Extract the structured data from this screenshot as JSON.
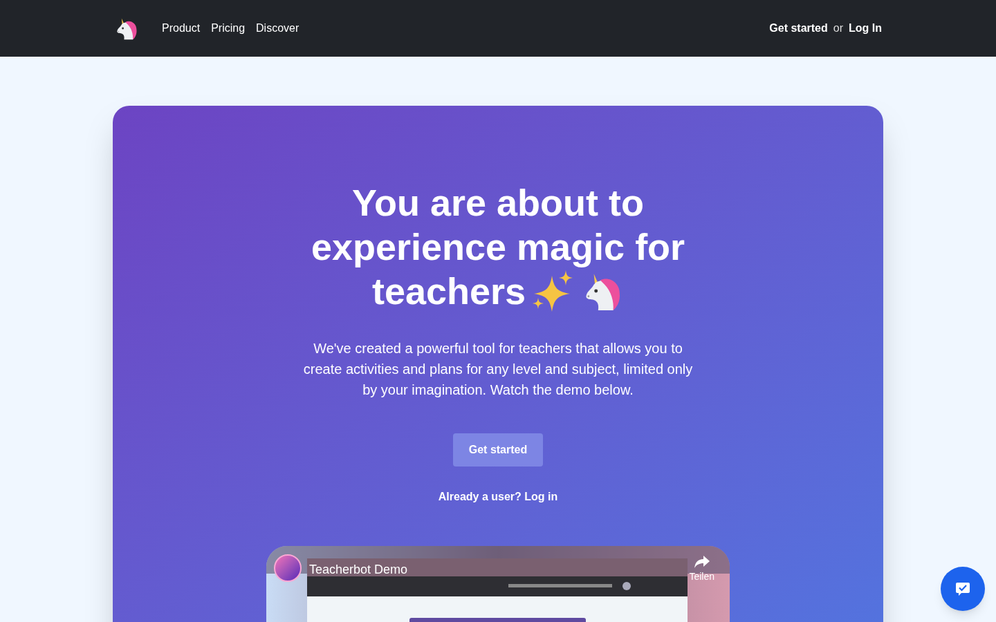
{
  "nav": {
    "links": [
      {
        "label": "Product"
      },
      {
        "label": "Pricing"
      },
      {
        "label": "Discover"
      }
    ],
    "get_started": "Get started",
    "or": "or",
    "log_in": "Log In"
  },
  "hero": {
    "title_lines": [
      "You are about to",
      "experience magic for",
      "teachers"
    ],
    "description": "We've created a powerful tool for teachers that allows you to create activities and plans for any level and subject, limited only by your imagination. Watch the demo below.",
    "button": "Get started",
    "login_link": "Already a user? Log in"
  },
  "video": {
    "kind": "picture",
    "title": "Teacherbot Demo",
    "share": "Teilen"
  }
}
